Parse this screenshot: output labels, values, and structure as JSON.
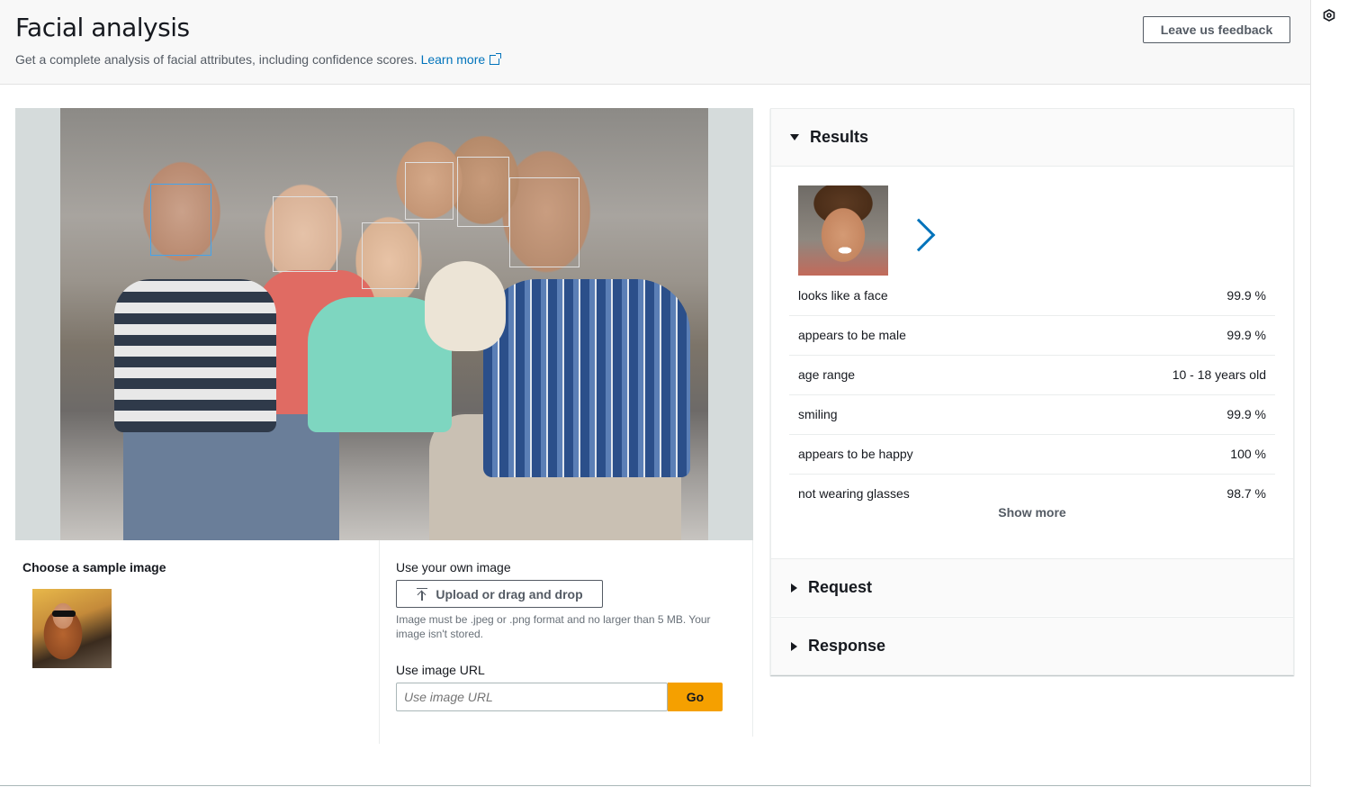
{
  "header": {
    "title": "Facial analysis",
    "subtitle": "Get a complete analysis of facial attributes, including confidence scores.",
    "learn_more": "Learn more",
    "feedback_button": "Leave us feedback"
  },
  "image": {
    "faces_detected": 6,
    "selected_face": 1
  },
  "sample": {
    "title": "Choose a sample image"
  },
  "own_image": {
    "label": "Use your own image",
    "upload_button": "Upload or drag and drop",
    "hint": "Image must be .jpeg or .png format and no larger than 5 MB. Your image isn't stored.",
    "url_label": "Use image URL",
    "url_placeholder": "Use image URL",
    "go_button": "Go"
  },
  "results": {
    "title": "Results",
    "attributes": [
      {
        "label": "looks like a face",
        "value": "99.9 %"
      },
      {
        "label": "appears to be male",
        "value": "99.9 %"
      },
      {
        "label": "age range",
        "value": "10 - 18 years old"
      },
      {
        "label": "smiling",
        "value": "99.9 %"
      },
      {
        "label": "appears to be happy",
        "value": "100 %"
      },
      {
        "label": "not wearing glasses",
        "value": "98.7 %"
      }
    ],
    "show_more": "Show more"
  },
  "request": {
    "title": "Request"
  },
  "response": {
    "title": "Response"
  },
  "colors": {
    "accent": "#0073bb",
    "go_button": "#f5a000",
    "selected_face_box": "#44a4ec"
  }
}
